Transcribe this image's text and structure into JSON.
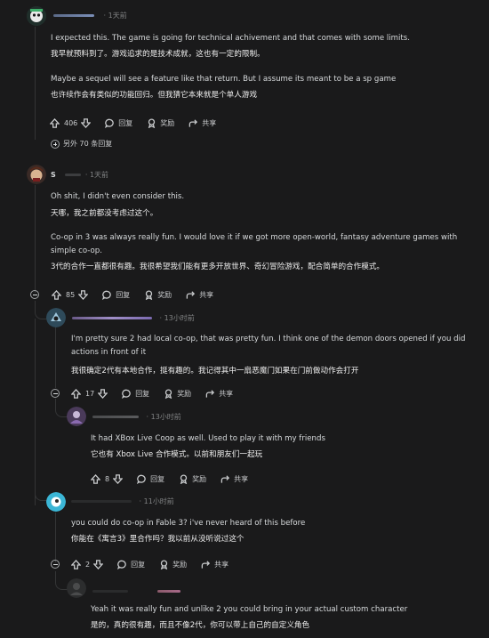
{
  "icons": {
    "upvote": "arrow-up-icon",
    "downvote": "arrow-down-icon",
    "reply": "speech-bubble-icon",
    "award": "award-ribbon-icon",
    "share": "share-arrow-icon",
    "collapse": "minus-circle-icon",
    "expand": "plus-circle-icon"
  },
  "colors": {
    "background": "#1a1a1b",
    "text": "#d7dadc",
    "meta": "#818384",
    "thread_line": "#343536"
  },
  "comments": [
    {
      "username": "",
      "time": "· 1天前",
      "paragraphs": [
        {
          "en": "I expected this. The game is going for technical achivement and that comes with some limits.",
          "zh": "我早就预料到了。游戏追求的是技术成就，这也有一定的限制。"
        },
        {
          "en": "Maybe a sequel will see a feature like that return. But I assume its meant to be a sp game",
          "zh": "也许续作会有类似的功能回归。但我猜它本来就是个单人游戏"
        }
      ],
      "votes": "406",
      "reply_label": "回复",
      "award_label": "奖励",
      "share_label": "共享",
      "more_replies": "另外 70 条回复"
    },
    {
      "username": "S",
      "time": "· 1天前",
      "paragraphs": [
        {
          "en": "Oh shit, I didn't even consider this.",
          "zh": "天哪，我之前都没考虑过这个。"
        },
        {
          "en": "Co-op in 3 was always really fun. I would love it if we got more open-world, fantasy adventure games with simple co-op.",
          "zh": "3代的合作一直都很有趣。我很希望我们能有更多开放世界、奇幻冒险游戏，配合简单的合作模式。"
        }
      ],
      "votes": "85",
      "reply_label": "回复",
      "award_label": "奖励",
      "share_label": "共享"
    },
    {
      "username": "",
      "time": "· 13小时前",
      "paragraphs": [
        {
          "en": "I'm pretty sure 2 had local co-op, that was pretty fun. I think one of the demon doors opened if you did actions in front of it",
          "zh": "我很确定2代有本地合作，挺有趣的。我记得其中一扇恶魔门如果在门前做动作会打开"
        }
      ],
      "votes": "17",
      "reply_label": "回复",
      "award_label": "奖励",
      "share_label": "共享"
    },
    {
      "username": "",
      "time": "· 13小时前",
      "paragraphs": [
        {
          "en": "It had XBox Live Coop as well. Used to play it with my friends",
          "zh": "它也有 Xbox Live 合作模式。以前和朋友们一起玩"
        }
      ],
      "votes": "8",
      "reply_label": "回复",
      "award_label": "奖励",
      "share_label": "共享"
    },
    {
      "username": "",
      "time": "· 11小时前",
      "paragraphs": [
        {
          "en": "you could do co-op in Fable 3? i've never heard of this before",
          "zh": "你能在《寓言3》里合作吗？我以前从没听说过这个"
        }
      ],
      "votes": "2",
      "reply_label": "回复",
      "award_label": "奖励",
      "share_label": "共享"
    },
    {
      "username": "",
      "time": "",
      "paragraphs": [
        {
          "en": "Yeah it was really fun and unlike 2 you could bring in your actual custom character",
          "zh": "是的，真的很有趣，而且不像2代，你可以带上自己的自定义角色"
        }
      ]
    }
  ]
}
